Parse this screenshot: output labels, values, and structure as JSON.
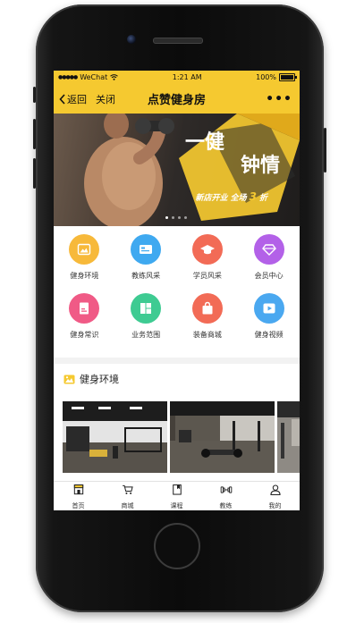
{
  "status_bar": {
    "carrier": "WeChat",
    "time": "1:21 AM",
    "battery": "100%",
    "battery_level": 1.0
  },
  "navbar": {
    "back_label": "返回",
    "close_label": "关闭",
    "title": "点赞健身房",
    "more_label": "•••"
  },
  "banner": {
    "headline_line1": "一健",
    "headline_line2": "钟情",
    "sub_text": "新店开业 全场",
    "discount_number": "3",
    "discount_unit": "折",
    "page_count": 4,
    "active_page": 1
  },
  "menu": {
    "rows": [
      [
        {
          "label": "健身环境",
          "icon": "image-icon",
          "color": "#f7b93a"
        },
        {
          "label": "教练风采",
          "icon": "id-card-icon",
          "color": "#3fa9f0"
        },
        {
          "label": "学员风采",
          "icon": "graduation-cap-icon",
          "color": "#f26b56"
        },
        {
          "label": "会员中心",
          "icon": "diamond-icon",
          "color": "#b361e8"
        }
      ],
      [
        {
          "label": "健身常识",
          "icon": "document-icon",
          "color": "#f05a86"
        },
        {
          "label": "业务范围",
          "icon": "grid-icon",
          "color": "#3ecb92"
        },
        {
          "label": "装备商城",
          "icon": "shopping-bag-icon",
          "color": "#f26b56"
        },
        {
          "label": "健身视频",
          "icon": "video-icon",
          "color": "#4aa8f0"
        }
      ]
    ]
  },
  "environment_section": {
    "title": "健身环境",
    "icon": "image-icon"
  },
  "tabbar": {
    "items": [
      {
        "label": "首页",
        "icon": "home-icon",
        "active": true
      },
      {
        "label": "商城",
        "icon": "cart-icon",
        "active": false
      },
      {
        "label": "课程",
        "icon": "bookmark-icon",
        "active": false
      },
      {
        "label": "教练",
        "icon": "dumbbell-icon",
        "active": false
      },
      {
        "label": "我的",
        "icon": "user-icon",
        "active": false
      }
    ]
  },
  "colors": {
    "accent": "#f5c930",
    "background": "#f2f2f2"
  }
}
